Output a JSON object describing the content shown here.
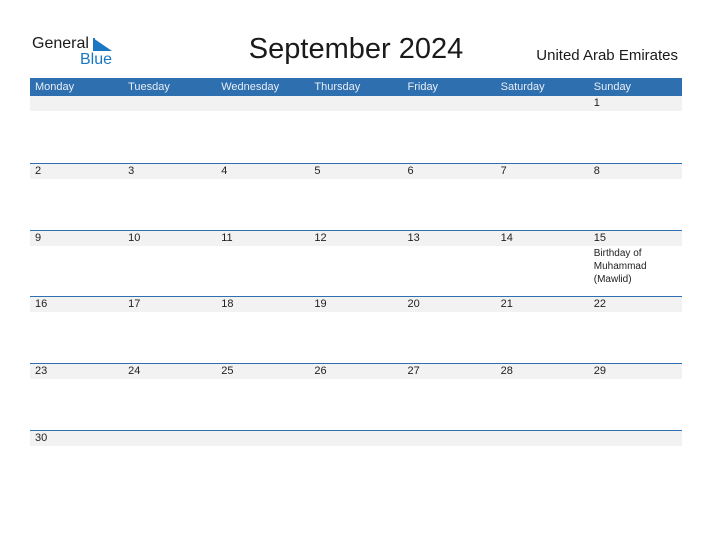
{
  "logo": {
    "general": "General",
    "blue": "Blue"
  },
  "title": "September 2024",
  "country": "United Arab Emirates",
  "weekdays": [
    "Monday",
    "Tuesday",
    "Wednesday",
    "Thursday",
    "Friday",
    "Saturday",
    "Sunday"
  ],
  "weeks": [
    {
      "days": [
        "",
        "",
        "",
        "",
        "",
        "",
        "1"
      ],
      "events": [
        "",
        "",
        "",
        "",
        "",
        "",
        ""
      ]
    },
    {
      "days": [
        "2",
        "3",
        "4",
        "5",
        "6",
        "7",
        "8"
      ],
      "events": [
        "",
        "",
        "",
        "",
        "",
        "",
        ""
      ]
    },
    {
      "days": [
        "9",
        "10",
        "11",
        "12",
        "13",
        "14",
        "15"
      ],
      "events": [
        "",
        "",
        "",
        "",
        "",
        "",
        "Birthday of Muhammad (Mawlid)"
      ]
    },
    {
      "days": [
        "16",
        "17",
        "18",
        "19",
        "20",
        "21",
        "22"
      ],
      "events": [
        "",
        "",
        "",
        "",
        "",
        "",
        ""
      ]
    },
    {
      "days": [
        "23",
        "24",
        "25",
        "26",
        "27",
        "28",
        "29"
      ],
      "events": [
        "",
        "",
        "",
        "",
        "",
        "",
        ""
      ]
    },
    {
      "days": [
        "30",
        "",
        "",
        "",
        "",
        "",
        ""
      ],
      "events": [
        "",
        "",
        "",
        "",
        "",
        "",
        ""
      ]
    }
  ],
  "colors": {
    "header": "#2e6faf",
    "strip": "#f2f2f2",
    "brand": "#1a78c2"
  }
}
